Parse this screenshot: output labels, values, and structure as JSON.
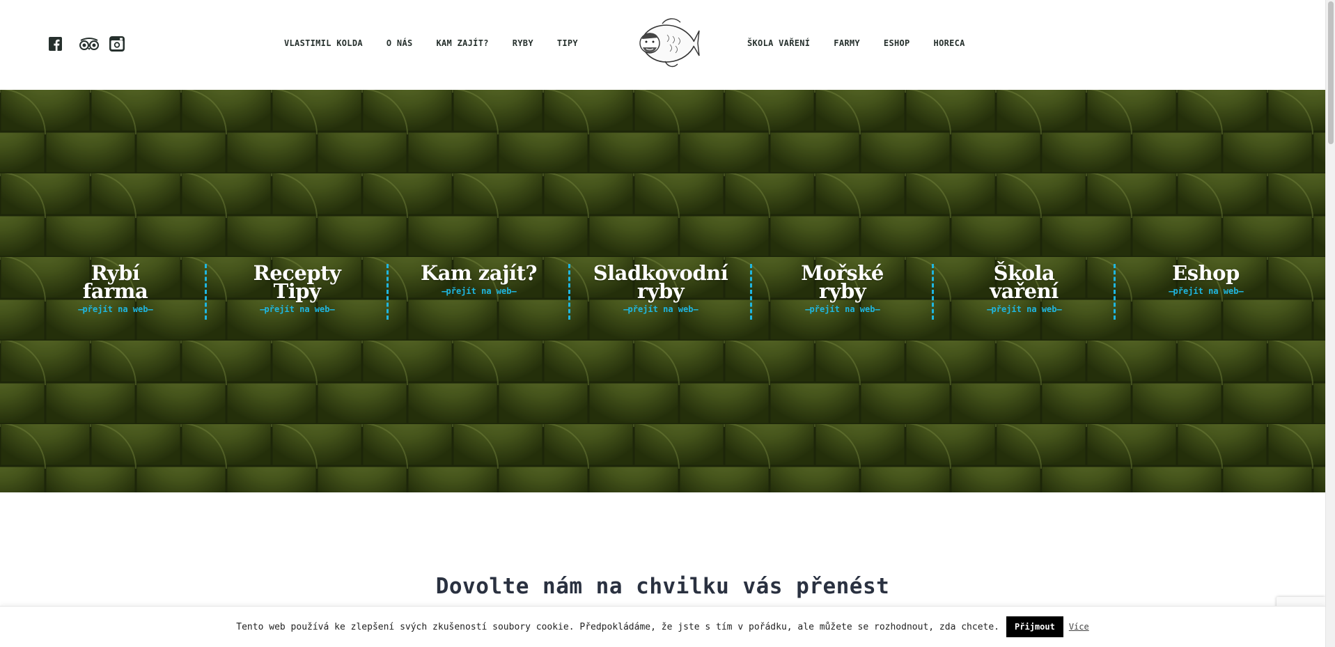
{
  "header": {
    "social": [
      {
        "name": "facebook",
        "icon": "facebook-icon"
      },
      {
        "name": "tripadvisor",
        "icon": "tripadvisor-icon"
      },
      {
        "name": "instagram",
        "icon": "instagram-icon"
      }
    ],
    "nav_left": [
      "VLASTIMIL KOLDA",
      "O NÁS",
      "KAM ZAJÍT?",
      "RYBY",
      "TIPY"
    ],
    "nav_right": [
      "ŠKOLA VAŘENÍ",
      "FARMY",
      "ESHOP",
      "HORECA"
    ],
    "logo": "fish-with-face-logo"
  },
  "hero": {
    "background": "green-fish-scales",
    "tiles": [
      {
        "title": [
          "Rybí",
          "farma"
        ],
        "cta": "přejít na web"
      },
      {
        "title": [
          "Recepty",
          "Tipy"
        ],
        "cta": "přejít na web"
      },
      {
        "title": [
          "Kam zajít?"
        ],
        "cta": "přejít na web"
      },
      {
        "title": [
          "Sladkovodní",
          "ryby"
        ],
        "cta": "přejít na web"
      },
      {
        "title": [
          "Mořské",
          "ryby"
        ],
        "cta": "přejít na web"
      },
      {
        "title": [
          "Škola",
          "vaření"
        ],
        "cta": "přejít na web"
      },
      {
        "title": [
          "Eshop"
        ],
        "cta": "přejít na web"
      }
    ]
  },
  "section": {
    "title": "Dovolte nám na chvilku vás přenést"
  },
  "cookie": {
    "text": "Tento web používá ke zlepšení svých zkušeností soubory cookie. Předpokládáme, že jste s tím v pořádku, ale můžete se rozhodnout, zda chcete.",
    "accept": "Přijmout",
    "more": "Více"
  },
  "colors": {
    "accent": "#1fb6e0",
    "scales_dark": "#2c3a10",
    "scales_light": "#5d6f2c",
    "text_dark": "#26302d"
  }
}
